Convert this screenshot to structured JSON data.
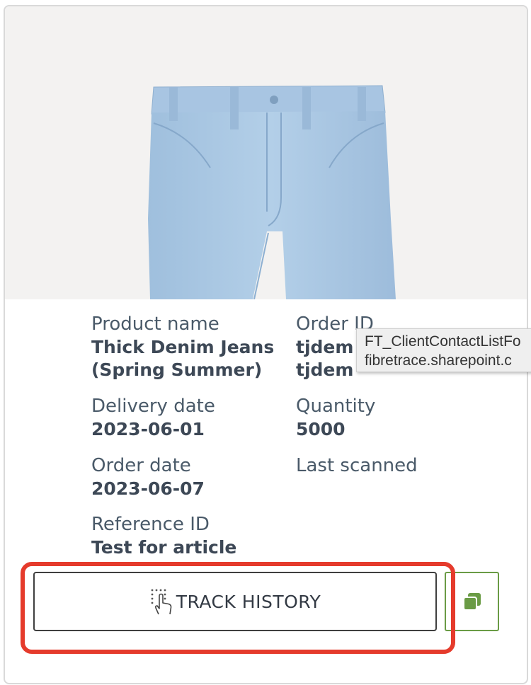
{
  "product_card": {
    "image_alt": "Light blue denim jeans",
    "fields": {
      "product_name": {
        "label": "Product name",
        "value_line1": "Thick Denim Jeans",
        "value_line2": "(Spring Summer)"
      },
      "order_id": {
        "label": "Order ID",
        "value_line1": "tjdem",
        "value_line2": "tjdem"
      },
      "delivery_date": {
        "label": "Delivery date",
        "value": "2023-06-01"
      },
      "quantity": {
        "label": "Quantity",
        "value": "5000"
      },
      "order_date": {
        "label": "Order date",
        "value": "2023-06-07"
      },
      "last_scanned": {
        "label": "Last scanned",
        "value": ""
      },
      "reference_id": {
        "label": "Reference ID",
        "value": "Test for article"
      }
    },
    "actions": {
      "track_history_label": "TRACK HISTORY",
      "copy_icon": "copy-icon",
      "track_icon": "pointer-hand-icon"
    }
  },
  "tooltip": {
    "line1": "FT_ClientContactListFo",
    "line2": "fibretrace.sharepoint.c"
  },
  "colors": {
    "highlight": "#e53b2c",
    "copy_accent": "#6a9b45",
    "jeans": "#a4c3e1"
  }
}
